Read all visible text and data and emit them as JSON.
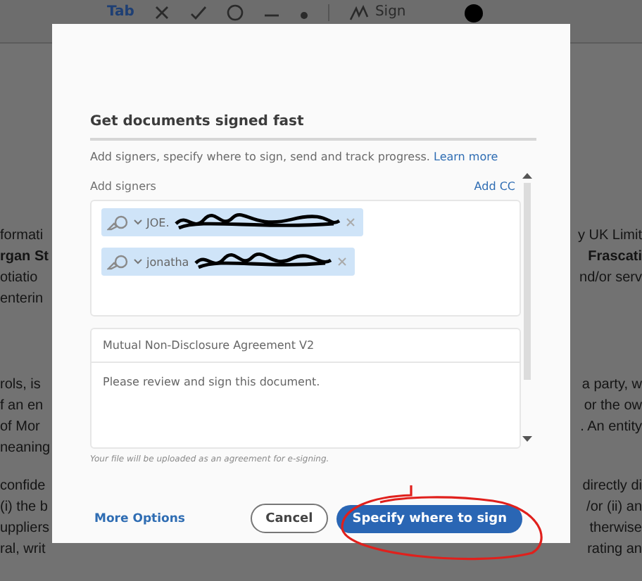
{
  "toolbar": {
    "tab_label": "Tab",
    "sign_label": "Sign"
  },
  "document": {
    "paragraphs": [
      {
        "lines": [
          {
            "left": "formati",
            "right": "y UK Limit",
            "bold": false
          },
          {
            "left": "rgan St",
            "right": "Frascati",
            "bold": true
          },
          {
            "left": "otiatio",
            "right": "nd/or serv",
            "bold": false
          },
          {
            "left": "enterin",
            "bold": false
          }
        ]
      },
      {
        "lines": [
          {
            "left": "rols, is",
            "right": "a party, w",
            "bold": false
          },
          {
            "left": "f an en",
            "right": "or the ow",
            "bold": false
          },
          {
            "left": "of Mor",
            "right": ". An entity",
            "bold": false
          },
          {
            "left": "neaning",
            "bold": false
          }
        ]
      },
      {
        "lines": [
          {
            "left": "confide",
            "right": "directly di",
            "bold": false
          },
          {
            "left": "(i) the b",
            "right": "/or (ii) an",
            "bold": false
          },
          {
            "left": "uppliers",
            "right": "therwise",
            "bold": false
          },
          {
            "left": "ral, writ",
            "right": "rating an",
            "bold": false
          }
        ]
      }
    ]
  },
  "dialog": {
    "title": "Get documents signed fast",
    "subtitle": "Add signers, specify where to sign, send and track progress.",
    "learn_more": "Learn more",
    "signers_label": "Add signers",
    "add_cc": "Add CC",
    "signers": [
      {
        "name": "JOE."
      },
      {
        "name": "jonatha"
      }
    ],
    "agreement_name": "Mutual Non-Disclosure Agreement V2",
    "message": "Please review and sign this document.",
    "note": "Your file will be uploaded as an agreement for e-signing.",
    "more_options": "More Options",
    "cancel": "Cancel",
    "primary": "Specify where to sign"
  }
}
